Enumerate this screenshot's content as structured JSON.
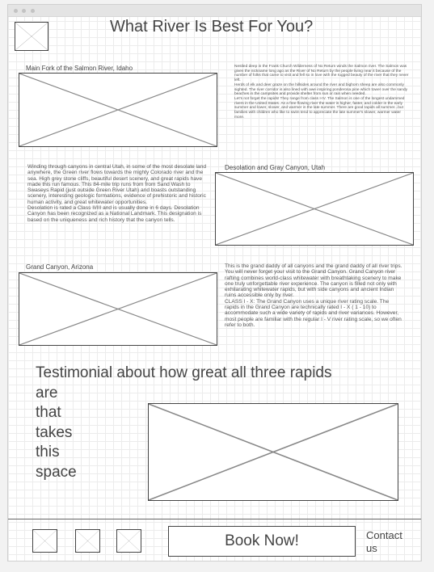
{
  "page": {
    "title": "What River Is Best For You?"
  },
  "sections": {
    "salmon": {
      "caption": "Main Fork of the Salmon River, Idaho",
      "paragraphs": [
        "Nestled deep in the Frank Church Wilderness of No Return winds the Salmon river. The Salmon was given the nickname long ago as the River of No Return by the people living near it because of the number of folks that came to visit and fell so in love with the rugged beauty of the river that they never left.",
        "Herds of elk and deer graze on the hillsides around the river and bighorn sheep are also commonly sighted. The river corridor is also lined with awe inspiring ponderosa pine which tower over the sandy beaches in the campsites and provide shelter from sun or rain when needed.",
        "Let's not forget the rapids! They range from class I-IV. The Salmon is one of the longest undammed rivers in the United States. As a free flowing river the water is higher, faster, and colder in the early summer and lower, slower, and warmer in the late summer. There are good rapids all summer...but families with children who like to swim tend to appreciate the late summer's slower, warmer water more."
      ]
    },
    "desolation": {
      "caption": "Desolation and Gray Canyon, Utah",
      "paragraphs": [
        "Winding through canyons in central Utah, in some of the most desolate land anywhere, the Green river flows towards the mighty Colorado river and the sea. High grey stone cliffs, beautiful desert scenery, and great rapids have made this run famous. This 84-mile trip runs from from Sand Wash to Swaseys Rapid (just outside Green River Utah) and boasts outstanding scenery, interesting geologic formations, evidence of prehistoric and historic human activity, and great whitewater opportunities.",
        "Desolation is rated a Class II/III and is usually done in 6 days. Desolation Canyon has been recognized as a National Landmark. This designation is based on the uniqueness and rich history that the canyon tells."
      ]
    },
    "grand_canyon": {
      "caption": "Grand Canyon, Arizona",
      "paragraphs": [
        "This is the grand daddy of all canyons and the grand daddy of all river trips. You will never forget your visit to the Grand Canyon. Grand Canyon river rafting combines world-class whitewater with breathtaking scenery to make one truly unforgettable river experience. The canyon is filled not only with exhilarating whitewater rapids, but with side canyons and ancient Indian ruins accessible only by river.",
        "CLASS I - X: The Grand Canyon uses a unique river rating scale. The rapids in the Grand Canyon are technically rated I - X ( 1 - 10) to accommodate such a wide variety of rapids and river variances. However, most people are familiar with the regular I - V river rating scale, so we often refer to both."
      ]
    },
    "testimonial": {
      "text": "Testimonial about how great all three rapids are that takes this space"
    }
  },
  "footer": {
    "book_label": "Book Now!",
    "contact_label": "Contact us"
  }
}
